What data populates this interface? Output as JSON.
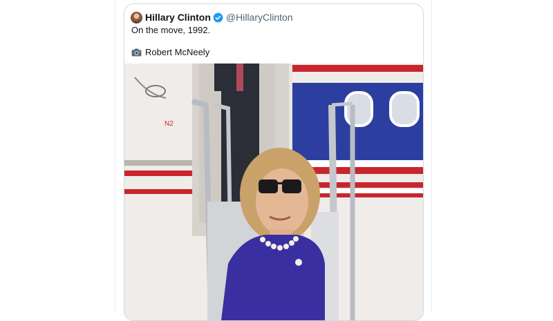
{
  "tweet": {
    "author": {
      "display_name": "Hillary Clinton",
      "handle": "@HillaryClinton",
      "verified": true,
      "avatar_icon": "avatar-photo"
    },
    "text": "On the move, 1992.",
    "credit_icon": "camera-icon",
    "credit": "Robert McNeely",
    "media": {
      "description_icon": "photo",
      "plane_stripe_color": "#c8262c",
      "plane_blue": "#2c3fa0",
      "suit_color": "#3a2fa0"
    }
  }
}
